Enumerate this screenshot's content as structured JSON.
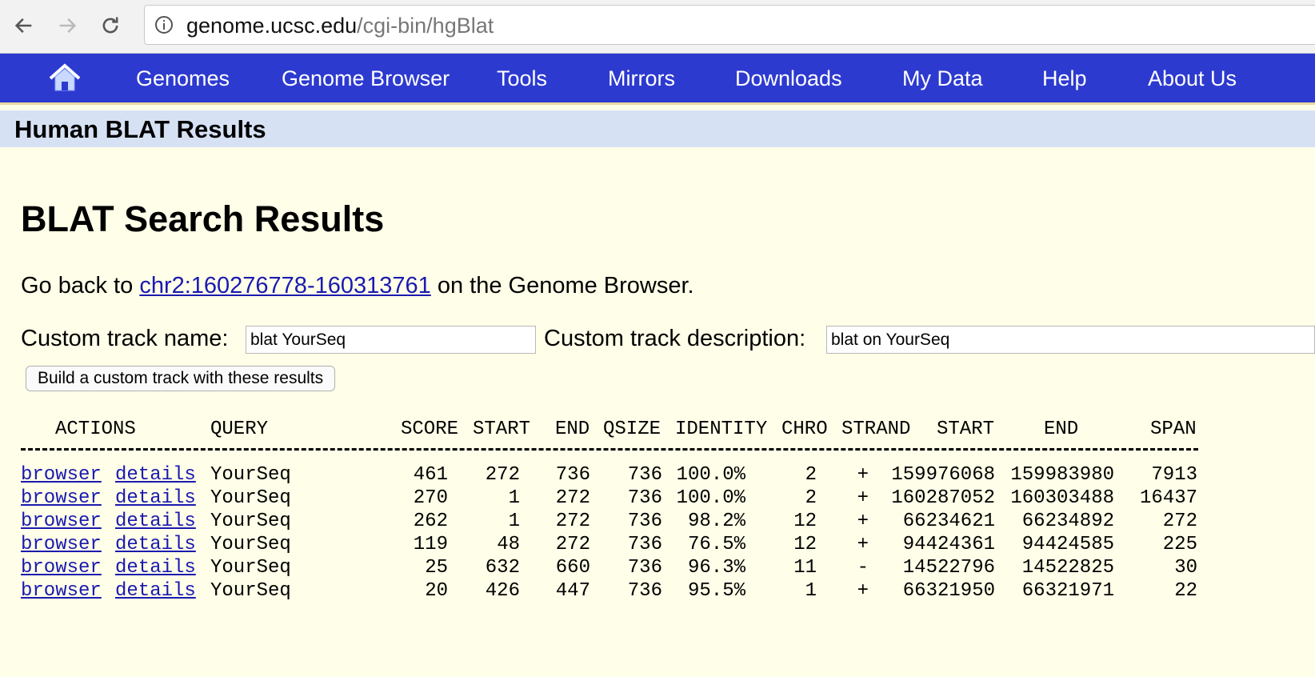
{
  "browser": {
    "url_host": "genome.ucsc.edu",
    "url_path": "/cgi-bin/hgBlat"
  },
  "nav": {
    "items": [
      "Genomes",
      "Genome Browser",
      "Tools",
      "Mirrors",
      "Downloads",
      "My Data",
      "Help",
      "About Us"
    ]
  },
  "title_bar": "Human BLAT Results",
  "heading": "BLAT Search Results",
  "go_back": {
    "prefix": "Go back to",
    "link": "chr2:160276778-160313761",
    "suffix": "on the Genome Browser."
  },
  "custom_track": {
    "name_label": "Custom track name:",
    "name_value": "blat YourSeq",
    "desc_label": "Custom track description:",
    "desc_value": "blat on YourSeq",
    "build_button": "Build a custom track with these results"
  },
  "table": {
    "headers": [
      "ACTIONS",
      "QUERY",
      "SCORE",
      "START",
      "END",
      "QSIZE",
      "IDENTITY",
      "CHRO",
      "STRAND",
      "START",
      "END",
      "SPAN"
    ],
    "action_labels": [
      "browser",
      "details"
    ],
    "rows": [
      [
        "YourSeq",
        "461",
        "272",
        "736",
        "736",
        "100.0%",
        "2",
        "+",
        "159976068",
        "159983980",
        "7913"
      ],
      [
        "YourSeq",
        "270",
        "1",
        "272",
        "736",
        "100.0%",
        "2",
        "+",
        "160287052",
        "160303488",
        "16437"
      ],
      [
        "YourSeq",
        "262",
        "1",
        "272",
        "736",
        "98.2%",
        "12",
        "+",
        "66234621",
        "66234892",
        "272"
      ],
      [
        "YourSeq",
        "119",
        "48",
        "272",
        "736",
        "76.5%",
        "12",
        "+",
        "94424361",
        "94424585",
        "225"
      ],
      [
        "YourSeq",
        "25",
        "632",
        "660",
        "736",
        "96.3%",
        "11",
        "-",
        "14522796",
        "14522825",
        "30"
      ],
      [
        "YourSeq",
        "20",
        "426",
        "447",
        "736",
        "95.5%",
        "1",
        "+",
        "66321950",
        "66321971",
        "22"
      ]
    ]
  }
}
